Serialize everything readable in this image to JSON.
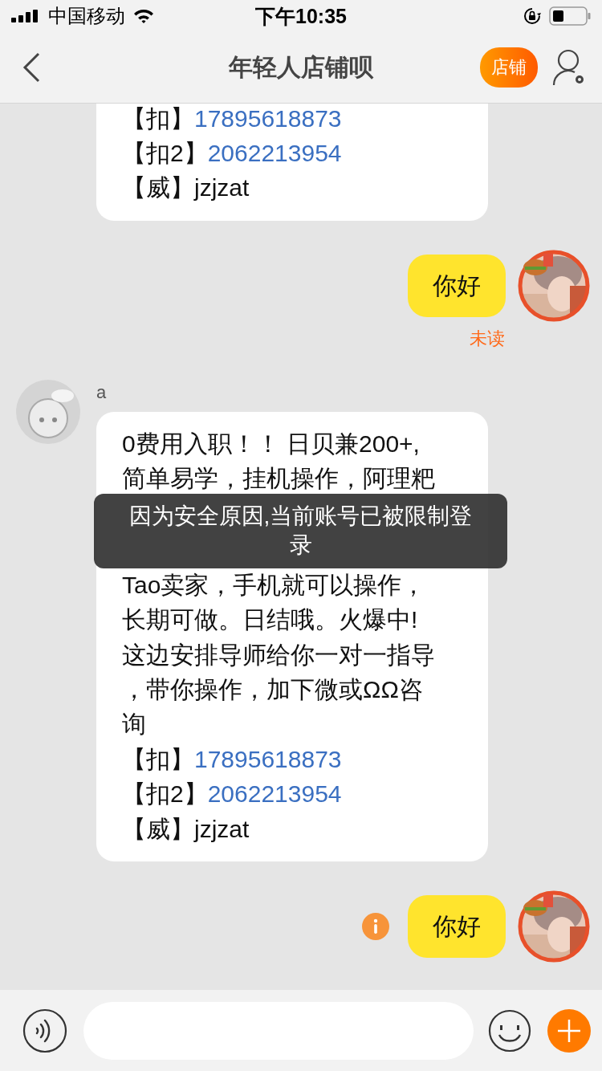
{
  "status_bar": {
    "carrier": "中国移动",
    "time": "下午10:35"
  },
  "nav": {
    "title": "年轻人店铺呗",
    "shop_button": "店铺"
  },
  "messages": [
    {
      "kind": "continued",
      "lines": [
        {
          "kind": "contact",
          "label": "【扣】",
          "value": "17895618873"
        },
        {
          "kind": "contact",
          "label": "【扣2】",
          "value": "2062213954"
        },
        {
          "kind": "text",
          "text": "【威】jzjzat"
        }
      ]
    },
    {
      "kind": "outgoing",
      "text": "你好",
      "status": "未读",
      "failed": false
    },
    {
      "kind": "incoming",
      "sender": "a",
      "lines": [
        {
          "kind": "text",
          "text": "0费用入职！！ 日贝兼200+,"
        },
        {
          "kind": "text",
          "text": "简单易学，挂机操作，阿理粑"
        },
        {
          "kind": "hidden"
        },
        {
          "kind": "text",
          "text": "Tao卖家，手机就可以操作，"
        },
        {
          "kind": "text",
          "text": "长期可做。日结哦。火爆中!"
        },
        {
          "kind": "text",
          "text": "这边安排导师给你一对一指导"
        },
        {
          "kind": "text",
          "text": "，带你操作，加下微或ΩΩ咨"
        },
        {
          "kind": "text",
          "text": "询"
        },
        {
          "kind": "contact",
          "label": "【扣】",
          "value": "17895618873"
        },
        {
          "kind": "contact",
          "label": "【扣2】",
          "value": "2062213954"
        },
        {
          "kind": "text",
          "text": "【威】jzjzat"
        }
      ]
    },
    {
      "kind": "outgoing",
      "text": "你好",
      "failed": true
    }
  ],
  "toast": "因为安全原因,当前账号已被限制登录"
}
